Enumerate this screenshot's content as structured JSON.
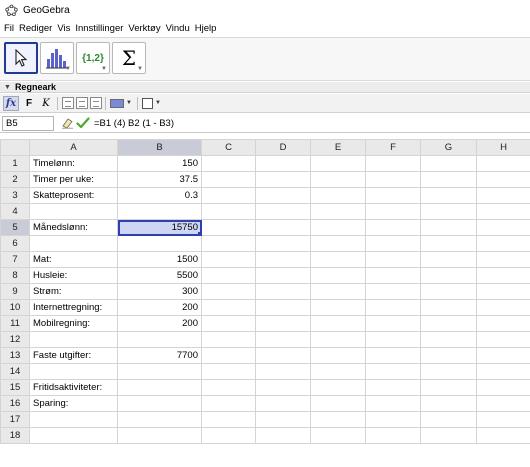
{
  "window": {
    "title": "GeoGebra"
  },
  "menu": [
    "Fil",
    "Rediger",
    "Vis",
    "Innstillinger",
    "Verktøy",
    "Vindu",
    "Hjelp"
  ],
  "toolbar": {
    "tools": [
      {
        "name": "move-tool",
        "icon": "cursor-arrow-icon",
        "selected": true
      },
      {
        "name": "statistics-tool",
        "icon": "bar-chart-icon",
        "selected": false
      },
      {
        "name": "list-tool",
        "icon": "list-braces-icon",
        "label": "{1,2}",
        "selected": false
      },
      {
        "name": "sum-tool",
        "icon": "sigma-icon",
        "label": "Σ",
        "selected": false
      }
    ]
  },
  "panel": {
    "title": "Regneark"
  },
  "format": {
    "fx": "fx",
    "bold": "F",
    "italic": "K"
  },
  "input": {
    "cell_ref": "B5",
    "formula": "=B1 (4) B2 (1 - B3)"
  },
  "columns": [
    "A",
    "B",
    "C",
    "D",
    "E",
    "F",
    "G",
    "H"
  ],
  "selected": {
    "row": 5,
    "col": "B"
  },
  "rows": [
    {
      "n": "1",
      "a": "Timelønn:",
      "b": "150"
    },
    {
      "n": "2",
      "a": "Timer per uke:",
      "b": "37.5"
    },
    {
      "n": "3",
      "a": "Skatteprosent:",
      "b": "0.3"
    },
    {
      "n": "4",
      "a": "",
      "b": ""
    },
    {
      "n": "5",
      "a": "Månedslønn:",
      "b": "15750"
    },
    {
      "n": "6",
      "a": "",
      "b": ""
    },
    {
      "n": "7",
      "a": "Mat:",
      "b": "1500"
    },
    {
      "n": "8",
      "a": "Husleie:",
      "b": "5500"
    },
    {
      "n": "9",
      "a": "Strøm:",
      "b": "300"
    },
    {
      "n": "10",
      "a": "Internettregning:",
      "b": "200"
    },
    {
      "n": "11",
      "a": "Mobilregning:",
      "b": "200"
    },
    {
      "n": "12",
      "a": "",
      "b": ""
    },
    {
      "n": "13",
      "a": "Faste utgifter:",
      "b": "7700"
    },
    {
      "n": "14",
      "a": "",
      "b": ""
    },
    {
      "n": "15",
      "a": "Fritidsaktiviteter:",
      "b": ""
    },
    {
      "n": "16",
      "a": "Sparing:",
      "b": ""
    },
    {
      "n": "17",
      "a": "",
      "b": ""
    },
    {
      "n": "18",
      "a": "",
      "b": ""
    }
  ]
}
